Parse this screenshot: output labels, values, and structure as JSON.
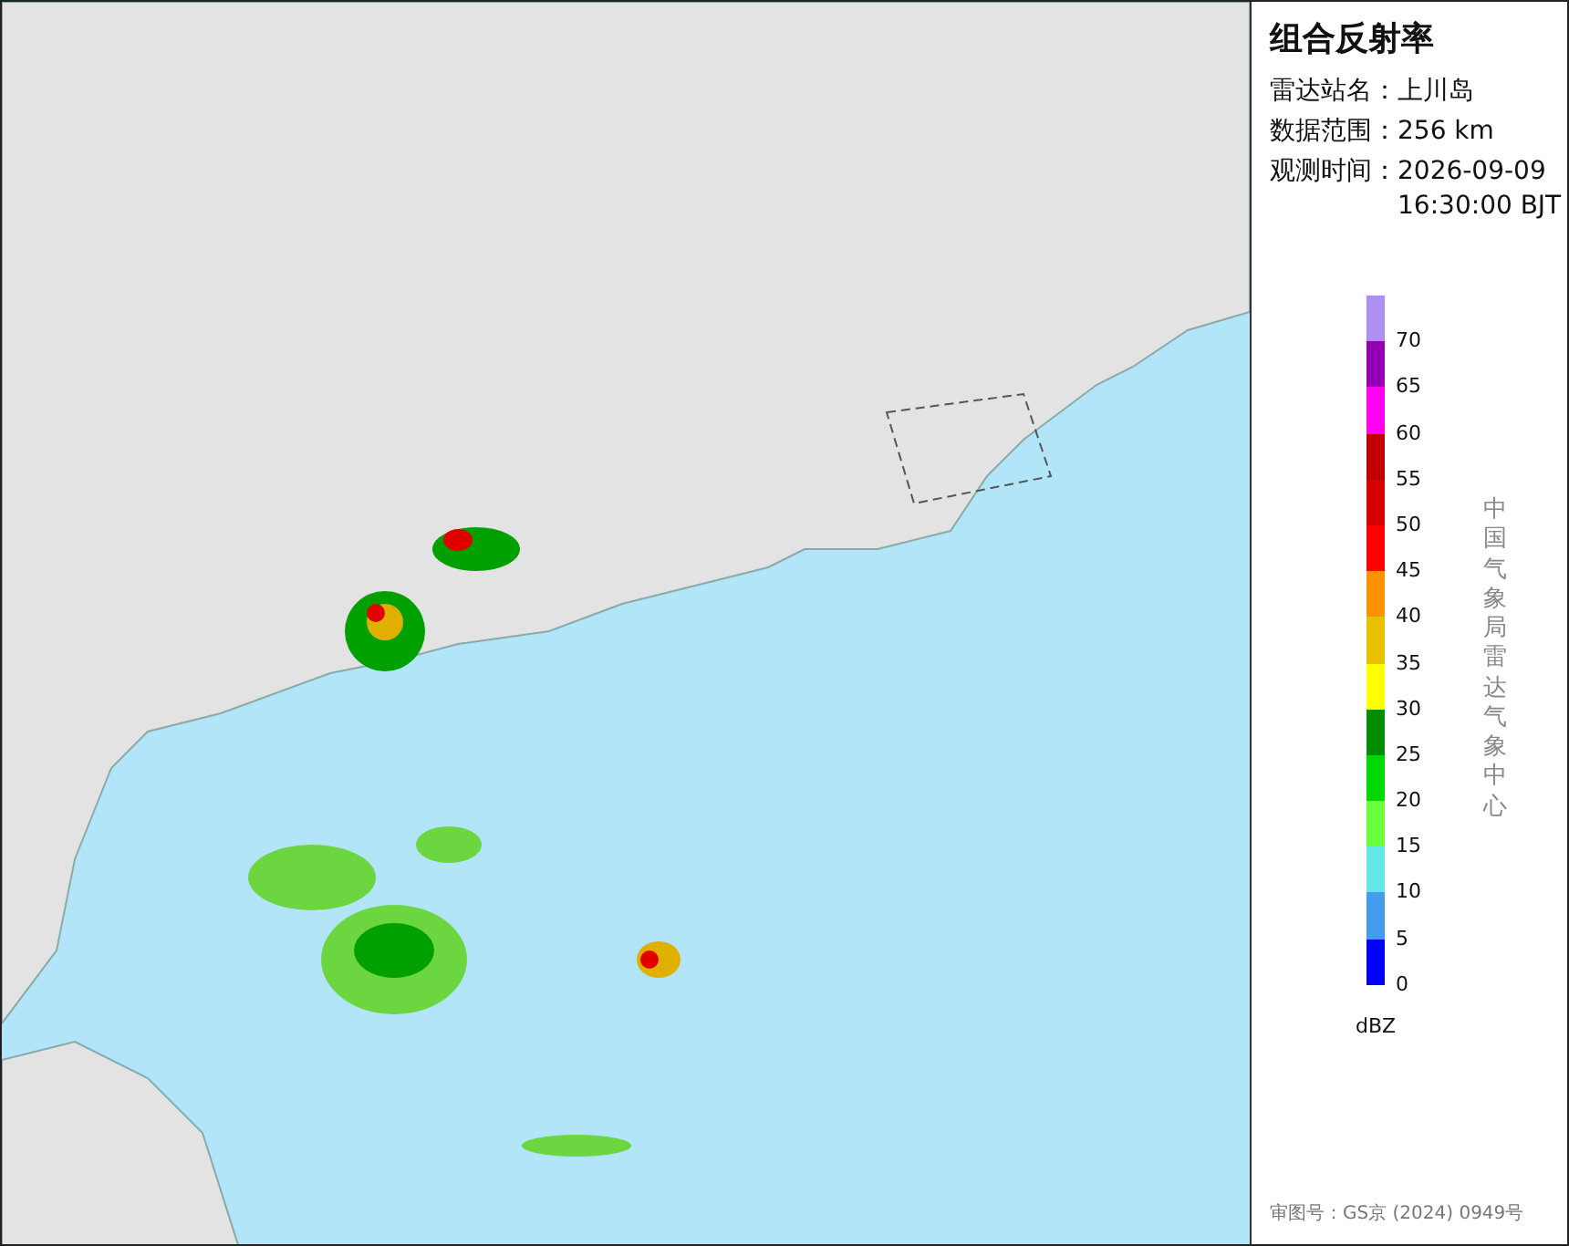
{
  "title": "组合反射率",
  "info": [
    {
      "label": "雷达站名：",
      "lines": [
        "上川岛"
      ]
    },
    {
      "label": "数据范围：",
      "lines": [
        "256 km"
      ]
    },
    {
      "label": "观测时间：",
      "lines": [
        "2026-09-09",
        "16:30:00 BJT"
      ]
    }
  ],
  "legend": {
    "bands": [
      {
        "color": "#ad90f0",
        "label": "70"
      },
      {
        "color": "#9300b4",
        "label": "65"
      },
      {
        "color": "#ff00f0",
        "label": "60"
      },
      {
        "color": "#c00000",
        "label": "55"
      },
      {
        "color": "#d60000",
        "label": "50"
      },
      {
        "color": "#ff0000",
        "label": "45"
      },
      {
        "color": "#ff9000",
        "label": "40"
      },
      {
        "color": "#e7c000",
        "label": "35"
      },
      {
        "color": "#ffff00",
        "label": "30"
      },
      {
        "color": "#008c00",
        "label": "25"
      },
      {
        "color": "#00d800",
        "label": "20"
      },
      {
        "color": "#6cff3c",
        "label": "15"
      },
      {
        "color": "#66e6e6",
        "label": "10"
      },
      {
        "color": "#449cf0",
        "label": "5"
      },
      {
        "color": "#0000f6",
        "label": "0"
      }
    ],
    "unit": "dBZ"
  },
  "credit": "中国气象局雷达气象中心",
  "approval": "审图号：GS京 (2024) 0949号"
}
